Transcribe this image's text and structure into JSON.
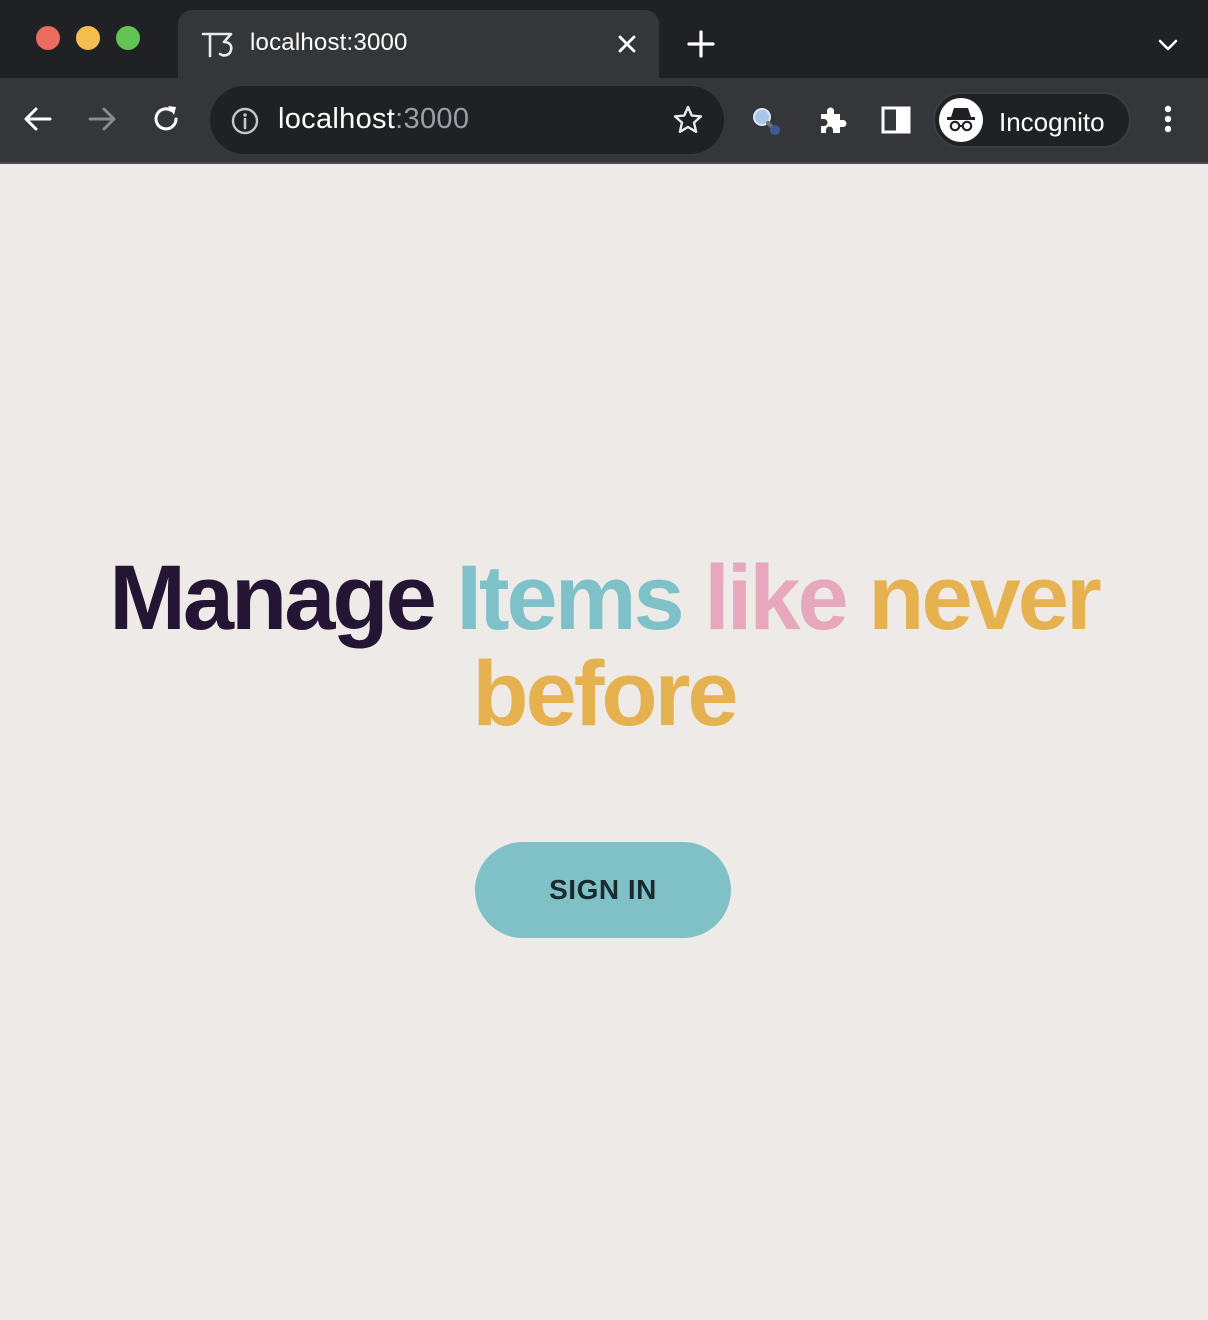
{
  "browser": {
    "tab": {
      "title": "localhost:3000",
      "favicon": "t3-logo-icon"
    },
    "omnibox": {
      "host": "localhost",
      "port": ":3000"
    },
    "profile": {
      "label": "Incognito"
    }
  },
  "hero": {
    "words": {
      "manage": "Manage",
      "items": "Items",
      "like": "like",
      "never": "never",
      "before": "before"
    }
  },
  "actions": {
    "sign_in": "SIGN IN"
  },
  "colors": {
    "background": "#eeeae7",
    "ink": "#241534",
    "teal": "#7fc1c8",
    "pink": "#e7a7bd",
    "gold": "#e6b14f"
  }
}
